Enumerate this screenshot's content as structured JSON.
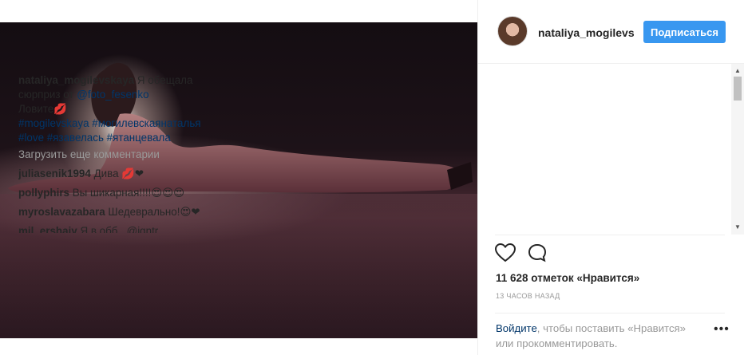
{
  "header": {
    "username": "nataliya_mogilevs",
    "follow_label": "Подписаться"
  },
  "caption": {
    "user": "nataliya_mogilevskaya",
    "text_line1": "Я обещала",
    "text_line2a": "сюрприз от ",
    "mention": "@foto_fesenko",
    "text_line3": "Ловите💋",
    "hashtags_line1": "#mogilevskaya #могилевскаянаталья",
    "hashtags_line2": "#love #язавелась #ятанцевала"
  },
  "load_more": "Загрузить еще комментарии",
  "comments": [
    {
      "user": "juliasenik1994",
      "text": "Дива 💋❤"
    },
    {
      "user": "pollyphirs",
      "text": "Вы шикарная!!!!😍😍😍"
    },
    {
      "user": "myroslavazabara",
      "text": "Шедеврально!😍❤"
    },
    {
      "user": "mil_ershaiy",
      "text": "Я в обб...@igntr"
    }
  ],
  "likes": "11 628 отметок «Нравится»",
  "timestamp": "13 ЧАСОВ НАЗАД",
  "login": {
    "link": "Войдите",
    "text": ", чтобы поставить «Нравится» или прокомментировать."
  },
  "more_label": "•••",
  "colors": {
    "accent": "#3897f0",
    "link": "#003569",
    "muted": "#999999"
  }
}
